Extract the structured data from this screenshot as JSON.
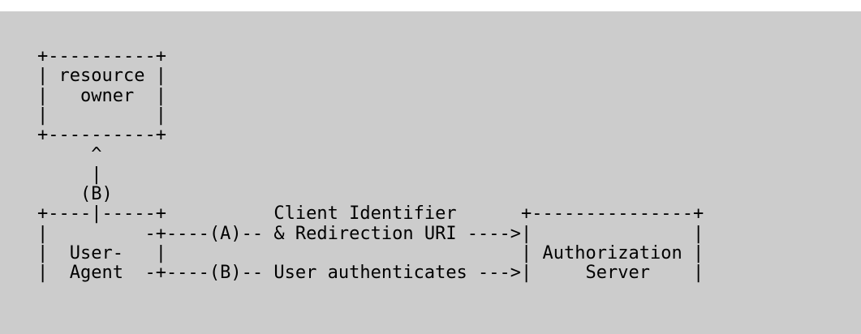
{
  "diagram": {
    "lines": [
      "+----------+",
      "| resource |",
      "|   owner  |",
      "|          |",
      "+----------+",
      "     ^",
      "     |",
      "    (B)",
      "+----|-----+          Client Identifier      +---------------+",
      "|         -+----(A)-- & Redirection URI ---->|               |",
      "|  User-   |                                 | Authorization |",
      "|  Agent  -+----(B)-- User authenticates --->|     Server    |"
    ]
  },
  "colors": {
    "background": "#cccccc",
    "text": "#000000"
  }
}
